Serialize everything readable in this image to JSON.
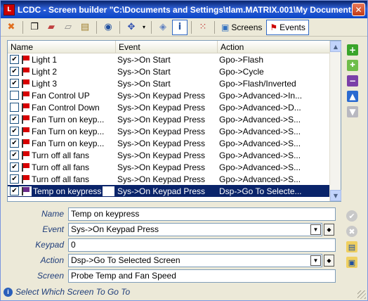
{
  "window": {
    "title": "LCDC - Screen builder \"C:\\Documents and Settings\\tlam.MATRIX.001\\My Document...",
    "app_icon": "lcdc-app-icon",
    "close_label": "✕"
  },
  "toolbar": {
    "screens_label": "Screens",
    "events_label": "Events",
    "active_tab": "Events"
  },
  "list": {
    "columns": [
      "Name",
      "Event",
      "Action"
    ],
    "rows": [
      {
        "checked": true,
        "name": "Light 1",
        "event": "Sys->On Start",
        "action": "Gpo->Flash"
      },
      {
        "checked": true,
        "name": "Light 2",
        "event": "Sys->On Start",
        "action": "Gpo->Cycle"
      },
      {
        "checked": true,
        "name": "Light 3",
        "event": "Sys->On Start",
        "action": "Gpo->Flash/Inverted"
      },
      {
        "checked": false,
        "name": "Fan Control UP",
        "event": "Sys->On Keypad Press",
        "action": "Gpo->Advanced->In..."
      },
      {
        "checked": false,
        "name": "Fan Control Down",
        "event": "Sys->On Keypad Press",
        "action": "Gpo->Advanced->D..."
      },
      {
        "checked": true,
        "name": "Fan Turn on keyp...",
        "event": "Sys->On Keypad Press",
        "action": "Gpo->Advanced->S..."
      },
      {
        "checked": true,
        "name": "Fan Turn on keyp...",
        "event": "Sys->On Keypad Press",
        "action": "Gpo->Advanced->S..."
      },
      {
        "checked": true,
        "name": "Fan Turn on keyp...",
        "event": "Sys->On Keypad Press",
        "action": "Gpo->Advanced->S..."
      },
      {
        "checked": true,
        "name": "Turn off all fans",
        "event": "Sys->On Keypad Press",
        "action": "Gpo->Advanced->S..."
      },
      {
        "checked": true,
        "name": "Turn off all fans",
        "event": "Sys->On Keypad Press",
        "action": "Gpo->Advanced->S..."
      },
      {
        "checked": true,
        "name": "Turn off all fans",
        "event": "Sys->On Keypad Press",
        "action": "Gpo->Advanced->S..."
      },
      {
        "checked": true,
        "name": "Temp on keypress",
        "event": "Sys->On Keypad Press",
        "action": "Dsp->Go To Selecte...",
        "selected": true
      }
    ]
  },
  "properties": {
    "name_label": "Name",
    "name_value": "Temp on keypress",
    "event_label": "Event",
    "event_value": "Sys->On Keypad Press",
    "keypad_label": "Keypad",
    "keypad_value": "0",
    "action_label": "Action",
    "action_value": "Dsp->Go To Selected Screen",
    "screen_label": "Screen",
    "screen_value": "Probe Temp and Fan Speed"
  },
  "status": {
    "text": "Select Which Screen To Go To"
  },
  "colors": {
    "selection": "#0a246a",
    "label_blue": "#1f3d7a"
  }
}
